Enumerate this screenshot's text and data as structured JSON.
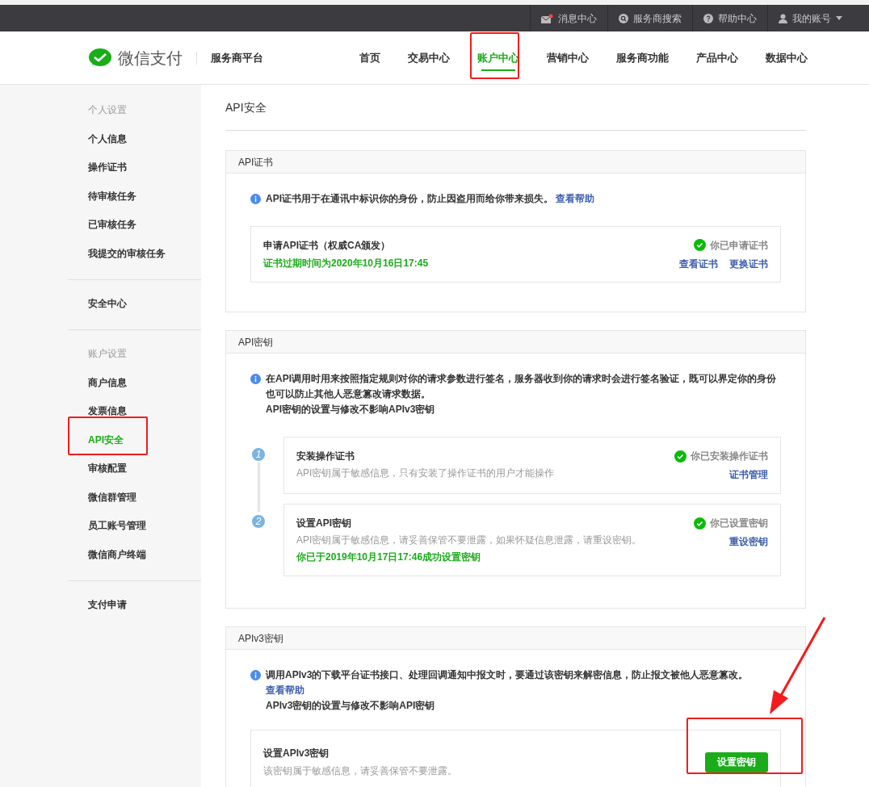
{
  "top_bar": {
    "items": [
      {
        "kind": "mail",
        "label": "消息中心",
        "unread": true
      },
      {
        "kind": "search",
        "label": "服务商搜索"
      },
      {
        "kind": "help",
        "label": "帮助中心"
      },
      {
        "kind": "account",
        "label": "我的账号"
      }
    ]
  },
  "header": {
    "logo_text": "微信支付",
    "platform": "服务商平台",
    "nav": [
      {
        "label": "首页",
        "selected": false
      },
      {
        "label": "交易中心",
        "selected": false
      },
      {
        "label": "账户中心",
        "selected": true
      },
      {
        "label": "营销中心",
        "selected": false
      },
      {
        "label": "服务商功能",
        "selected": false
      },
      {
        "label": "产品中心",
        "selected": false
      },
      {
        "label": "数据中心",
        "selected": false
      }
    ]
  },
  "sidebar": {
    "groups": [
      {
        "heading": "个人设置",
        "items": [
          {
            "label": "个人信息",
            "selected": false
          },
          {
            "label": "操作证书",
            "selected": false
          },
          {
            "label": "待审核任务",
            "selected": false
          },
          {
            "label": "已审核任务",
            "selected": false
          },
          {
            "label": "我提交的审核任务",
            "selected": false
          }
        ]
      },
      {
        "items": [
          {
            "label": "安全中心",
            "selected": false
          }
        ]
      },
      {
        "heading": "账户设置",
        "items": [
          {
            "label": "商户信息",
            "selected": false
          },
          {
            "label": "发票信息",
            "selected": false
          },
          {
            "label": "API安全",
            "selected": true
          },
          {
            "label": "审核配置",
            "selected": false
          },
          {
            "label": "微信群管理",
            "selected": false
          },
          {
            "label": "员工账号管理",
            "selected": false
          },
          {
            "label": "微信商户终端",
            "selected": false
          }
        ]
      },
      {
        "items": [
          {
            "label": "支付申请",
            "selected": false
          }
        ]
      }
    ]
  },
  "page_title": "API安全",
  "cert_section": {
    "title": "API证书",
    "info": "API证书用于在通讯中标识你的身份，防止因盗用而给你带来损失。",
    "help_link": "查看帮助",
    "card": {
      "title": "申请API证书（权威CA颁发）",
      "expiry": "证书过期时间为2020年10月16日17:45",
      "status": "你已申请证书",
      "links": [
        "查看证书",
        "更换证书"
      ]
    }
  },
  "key_section": {
    "title": "API密钥",
    "info": "在API调用时用来按照指定规则对你的请求参数进行签名，服务器收到你的请求时会进行签名验证，既可以界定你的身份也可以防止其他人恶意篡改请求数据。",
    "note": "API密钥的设置与修改不影响APIv3密钥",
    "steps": [
      {
        "number": "1",
        "title": "安装操作证书",
        "desc": "API密钥属于敏感信息，只有安装了操作证书的用户才能操作",
        "status": "你已安装操作证书",
        "link": "证书管理"
      },
      {
        "number": "2",
        "title": "设置API密钥",
        "desc": "API密钥属于敏感信息，请妥善保管不要泄露，如果怀疑信息泄露，请重设密钥。",
        "success": "你已于2019年10月17日17:46成功设置密钥",
        "status": "你已设置密钥",
        "link": "重设密钥"
      }
    ]
  },
  "v3_section": {
    "title": "APIv3密钥",
    "info": "调用APIv3的下载平台证书接口、处理回调通知中报文时，要通过该密钥来解密信息，防止报文被他人恶意篡改。",
    "help_link": "查看帮助",
    "note": "APIv3密钥的设置与修改不影响API密钥",
    "card": {
      "title": "设置APIv3密钥",
      "desc": "该密钥属于敏感信息，请妥善保管不要泄露。",
      "button": "设置密钥"
    }
  }
}
